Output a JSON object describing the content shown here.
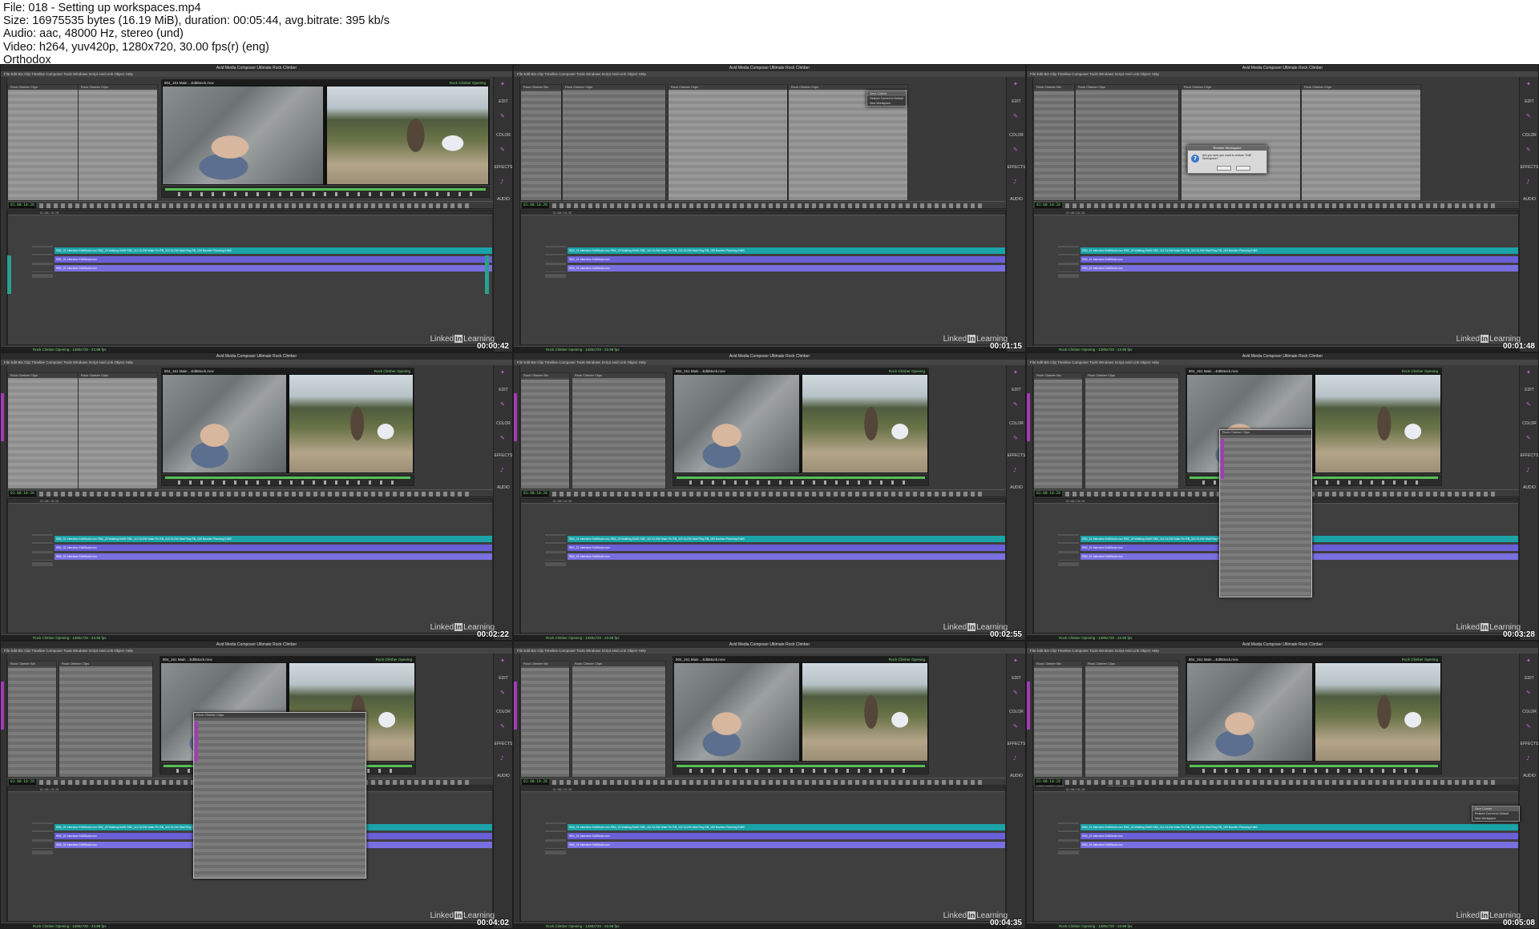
{
  "header": {
    "file": "File: 018 - Setting up workspaces.mp4",
    "size": "Size: 16975535 bytes (16.19 MiB), duration: 00:05:44, avg.bitrate: 395 kb/s",
    "audio": "Audio: aac, 48000 Hz, stereo (und)",
    "video": "Video: h264, yuv420p, 1280x720, 30.00 fps(r) (eng)",
    "credit": "Orthodox"
  },
  "app": {
    "window_title": "Avid Media Composer Ultimate Rock Climber",
    "menu": "File  Edit  Bin  Clip  Timeline  Composer  Tools  Windows  Script  Avid Link  Object  Help",
    "right_bar": [
      "EDIT",
      "COLOR",
      "EFFECTS",
      "AUDIO"
    ],
    "left_strip_label": "Timeline",
    "timecode": "01:00:10:28",
    "viewer_left_title": "804_151 Main ...Edit5tock.mov",
    "viewer_right_title": "Rock Climber Opening",
    "status": "Rock Climber Opening - 1280x720 - 23.98 fps",
    "bin_title": "Rock Climber Clips",
    "bins": [
      "Rock Climber Bin",
      "Rock Climber Clips",
      "Amazing Bins",
      "Another Folder",
      "Sequences"
    ],
    "clip_rows": [
      "RB_04 Clipping In EditStock.mov",
      "RB_31 Climbing Hanging EditStock.mov",
      "RB_45 Bouldering On Top EditStock.mov",
      "RB4_151 Main Climbing EditStock.mov"
    ],
    "track_v1": "RB2_01 Interview EditStock.mov   RB2_20 Walking EditS   RB2_114 SLOW Main Fin   RB_115 SLOW Wall Fing   RB_150 Boulder Planning EditS",
    "track_a1": "RB2_01 Interview EditStock.mov",
    "track_a2": "RB2_01 Interview EditStock.mov",
    "dialog_title": "Restore Workspace",
    "dialog_text": "Are you sure you want to restore \"Edit\" Workspace?",
    "ctx_items": [
      "Save Current",
      "Restore Current to Default",
      "New Workspace"
    ],
    "watermark_left": "Linked",
    "watermark_box": "in",
    "watermark_right": "Learning"
  },
  "thumbnails": [
    {
      "stamp": "00:00:42"
    },
    {
      "stamp": "00:01:15"
    },
    {
      "stamp": "00:01:48"
    },
    {
      "stamp": "00:02:22"
    },
    {
      "stamp": "00:02:55"
    },
    {
      "stamp": "00:03:28"
    },
    {
      "stamp": "00:04:02"
    },
    {
      "stamp": "00:04:35"
    },
    {
      "stamp": "00:05:08"
    }
  ]
}
